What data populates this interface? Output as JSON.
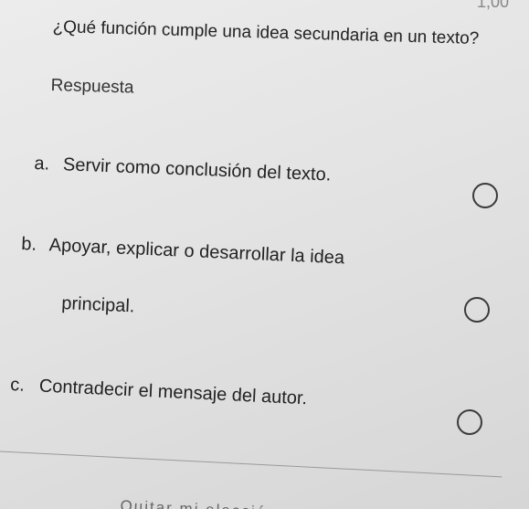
{
  "header": {
    "corner_text": "1,00"
  },
  "question": {
    "text": "¿Qué función cumple una idea secundaria en un texto?",
    "answer_label": "Respuesta"
  },
  "options": [
    {
      "letter": "a.",
      "text": "Servir como conclusión del texto."
    },
    {
      "letter": "b.",
      "text_line1": "Apoyar, explicar o desarrollar la idea",
      "text_line2": "principal."
    },
    {
      "letter": "c.",
      "text": "Contradecir el mensaje del autor."
    }
  ],
  "footer": {
    "clear_label": "Quitar mi elección"
  }
}
